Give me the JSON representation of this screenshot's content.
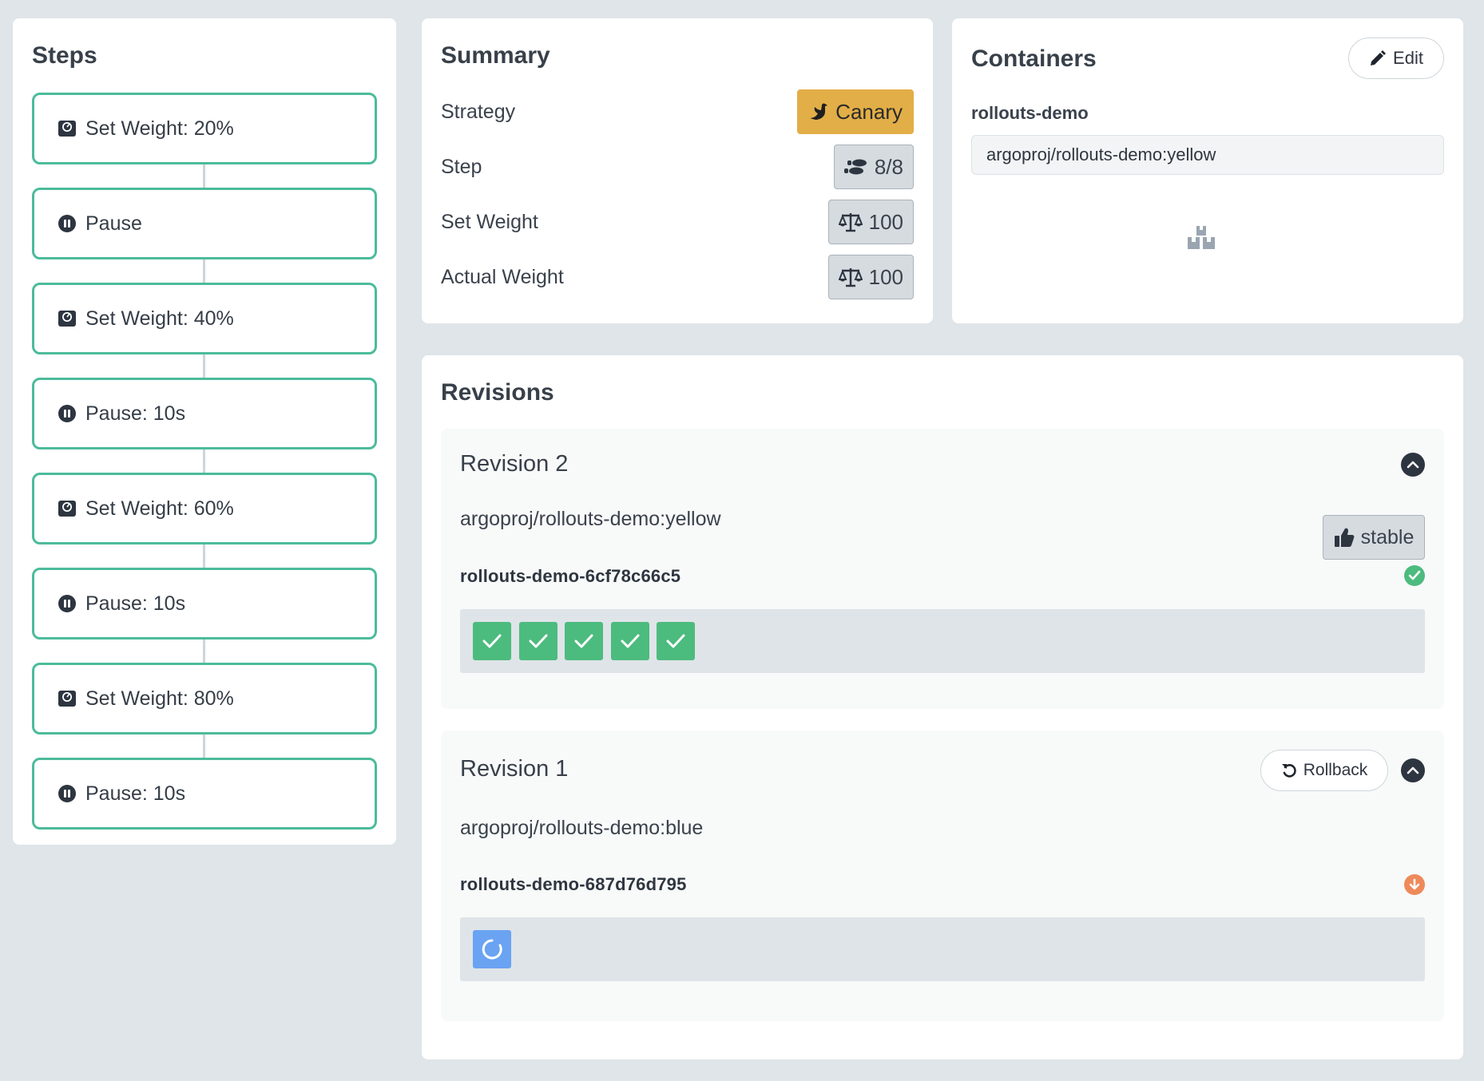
{
  "steps": {
    "title": "Steps",
    "items": [
      {
        "type": "weight",
        "label": "Set Weight: 20%"
      },
      {
        "type": "pause",
        "label": "Pause"
      },
      {
        "type": "weight",
        "label": "Set Weight: 40%"
      },
      {
        "type": "pause",
        "label": "Pause: 10s"
      },
      {
        "type": "weight",
        "label": "Set Weight: 60%"
      },
      {
        "type": "pause",
        "label": "Pause: 10s"
      },
      {
        "type": "weight",
        "label": "Set Weight: 80%"
      },
      {
        "type": "pause",
        "label": "Pause: 10s"
      }
    ]
  },
  "summary": {
    "title": "Summary",
    "strategy_label": "Strategy",
    "strategy_value": "Canary",
    "step_label": "Step",
    "step_value": "8/8",
    "set_weight_label": "Set Weight",
    "set_weight_value": "100",
    "actual_weight_label": "Actual Weight",
    "actual_weight_value": "100"
  },
  "containers": {
    "title": "Containers",
    "edit_label": "Edit",
    "name": "rollouts-demo",
    "image": "argoproj/rollouts-demo:yellow"
  },
  "revisions": {
    "title": "Revisions",
    "items": [
      {
        "title": "Revision 2",
        "image": "argoproj/rollouts-demo:yellow",
        "badge": "stable",
        "replicaset": "rollouts-demo-6cf78c66c5",
        "status": "healthy",
        "pods": [
          "ready",
          "ready",
          "ready",
          "ready",
          "ready"
        ]
      },
      {
        "title": "Revision 1",
        "rollback_label": "Rollback",
        "image": "argoproj/rollouts-demo:blue",
        "replicaset": "rollouts-demo-687d76d795",
        "status": "scaled-down",
        "pods": [
          "progressing"
        ]
      }
    ]
  },
  "colors": {
    "background": "#dfe5e8",
    "step_border": "#4cbb9b",
    "canary": "#e2ae47",
    "pod_ready": "#4cbb7e",
    "pod_progressing": "#6aa3f2",
    "status_healthy": "#4cbb7e",
    "status_scaled_down": "#ee8a5a"
  },
  "icons": {
    "weight_step": "weight-scale-icon",
    "pause_step": "pause-circle-icon",
    "strategy": "dove-icon",
    "step": "shoe-prints-icon",
    "weight": "balance-scale-icon",
    "edit": "pencil-icon",
    "containers_placeholder": "cubes-icon",
    "collapse": "chevron-up-icon",
    "stable": "thumbs-up-icon",
    "healthy": "check-circle-icon",
    "scaled_down": "arrow-circle-down-icon",
    "rollback": "undo-icon",
    "pod_ready": "check-icon",
    "pod_progressing": "spinner-icon"
  }
}
